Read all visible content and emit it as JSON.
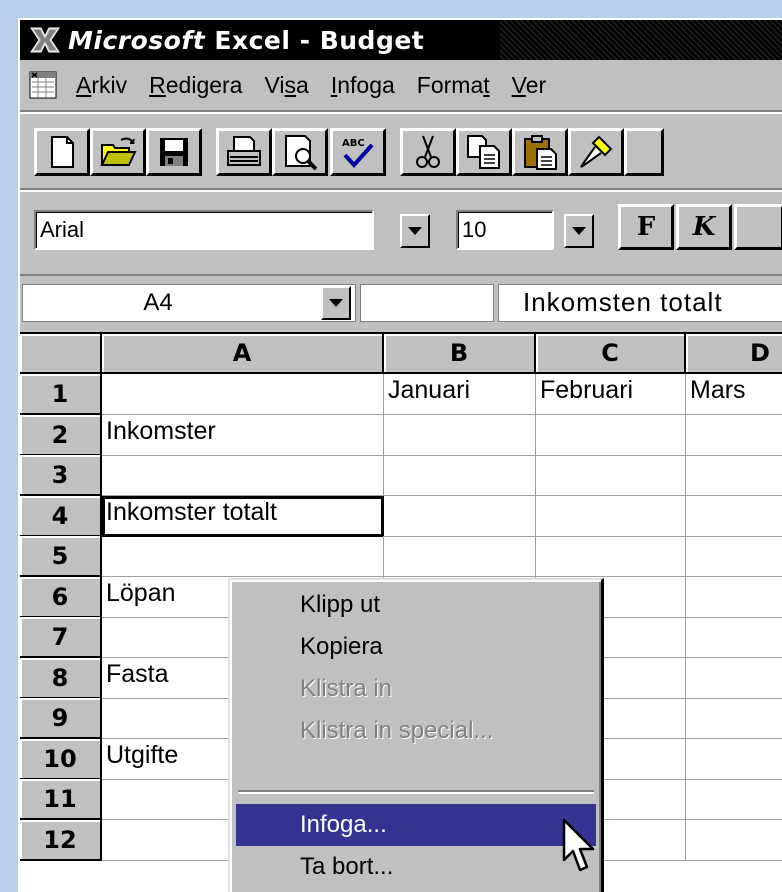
{
  "window": {
    "title_brand": "Microsoft",
    "title_rest": " Excel - Budget"
  },
  "menubar": {
    "items": [
      {
        "pre": "",
        "key": "A",
        "post": "rkiv"
      },
      {
        "pre": "",
        "key": "R",
        "post": "edigera"
      },
      {
        "pre": "Vi",
        "key": "s",
        "post": "a"
      },
      {
        "pre": "",
        "key": "I",
        "post": "nfoga"
      },
      {
        "pre": "Forma",
        "key": "t",
        "post": ""
      },
      {
        "pre": "",
        "key": "V",
        "post": "er"
      }
    ]
  },
  "toolbar": {
    "icons": [
      "new-document-icon",
      "open-folder-icon",
      "save-disk-icon",
      "print-icon",
      "print-preview-icon",
      "spelling-check-icon",
      "cut-scissors-icon",
      "copy-icon",
      "paste-icon",
      "format-painter-icon"
    ]
  },
  "format_toolbar": {
    "font": "Arial",
    "size": "10",
    "bold_label": "F",
    "italic_label": "K"
  },
  "formula_bar": {
    "name_box": "A4",
    "content": "Inkomsten totalt"
  },
  "grid": {
    "columns": [
      "A",
      "B",
      "C",
      "D"
    ],
    "rows": [
      {
        "num": "1",
        "A": "",
        "B": "Januari",
        "C": "Februari",
        "D": "Mars"
      },
      {
        "num": "2",
        "A": "Inkomster",
        "B": "",
        "C": "",
        "D": ""
      },
      {
        "num": "3",
        "A": "",
        "B": "",
        "C": "",
        "D": ""
      },
      {
        "num": "4",
        "A": "Inkomster totalt",
        "B": "",
        "C": "",
        "D": ""
      },
      {
        "num": "5",
        "A": "",
        "B": "",
        "C": "",
        "D": ""
      },
      {
        "num": "6",
        "A": "Löpan",
        "B": "",
        "C": "",
        "D": ""
      },
      {
        "num": "7",
        "A": "",
        "B": "",
        "C": "",
        "D": ""
      },
      {
        "num": "8",
        "A": "Fasta",
        "B": "",
        "C": "",
        "D": ""
      },
      {
        "num": "9",
        "A": "",
        "B": "",
        "C": "",
        "D": ""
      },
      {
        "num": "10",
        "A": "Utgifte",
        "B": "",
        "C": "",
        "D": ""
      },
      {
        "num": "11",
        "A": "",
        "B": "",
        "C": "",
        "D": ""
      },
      {
        "num": "12",
        "A": "",
        "B": "",
        "C": "",
        "D": ""
      }
    ]
  },
  "context_menu": {
    "items": [
      {
        "label": "Klipp ut",
        "state": "enabled"
      },
      {
        "label": "Kopiera",
        "state": "enabled"
      },
      {
        "label": "Klistra in",
        "state": "disabled"
      },
      {
        "label": "Klistra in special...",
        "state": "disabled"
      },
      {
        "label": "Infoga...",
        "state": "selected"
      },
      {
        "label": "Ta bort...",
        "state": "enabled"
      }
    ],
    "highlight_color": "#343392"
  }
}
